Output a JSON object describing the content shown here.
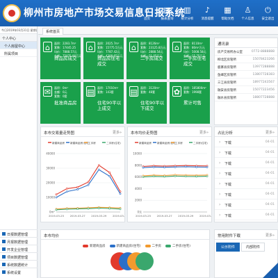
{
  "header": {
    "title": "柳州市房地产市场交易信息日报系统",
    "nav": [
      {
        "icon": "home-icon",
        "glyph": "⌂",
        "label": "首页"
      },
      {
        "icon": "document-icon",
        "glyph": "▤",
        "label": "报表查询"
      },
      {
        "icon": "chart-icon",
        "glyph": "▥",
        "label": "统计分析"
      },
      {
        "icon": "bell-icon",
        "glyph": "♪",
        "label": "消息提醒"
      },
      {
        "icon": "book-icon",
        "glyph": "▦",
        "label": "帮助文档"
      },
      {
        "icon": "user-icon",
        "glyph": "♙",
        "label": "个人信息"
      },
      {
        "icon": "exit-icon",
        "glyph": "⏻",
        "label": "安全退出"
      }
    ]
  },
  "sidebar": {
    "today": "今日2019年03月31日 星期日",
    "group_label": "个人中心",
    "items": [
      {
        "label": "个人房屋中心"
      },
      {
        "label": "所属项目"
      }
    ],
    "modules": [
      {
        "label": "日报数据管理"
      },
      {
        "label": "月报数据管理"
      },
      {
        "label": "开发企业管理"
      },
      {
        "label": "项目数据管理"
      },
      {
        "label": "系统数据统计"
      },
      {
        "label": "系统设置"
      }
    ]
  },
  "tabbar": {
    "home_tab": "系统首页"
  },
  "tiles": [
    {
      "icon": "house-icon",
      "glyph": "⌂",
      "lines": [
        "面积：2283.7m²",
        "套数：17445.25",
        "均价：7888.57元",
        "金额：75875.88万元"
      ],
      "name": "商品房成交"
    },
    {
      "icon": "house-icon",
      "glyph": "⌂",
      "lines": [
        "面积：2025.7m²",
        "套数：15775.5万元",
        "均价：7787.42元",
        "金额：4288.65万元"
      ],
      "name": "商品房住宅成交"
    },
    {
      "icon": "house-icon",
      "glyph": "⌂",
      "lines": [
        "面积：8126m²",
        "套数：23125.8万元",
        "均价：2888.54元",
        "金额：31.05万元"
      ],
      "name": "二手房成交"
    },
    {
      "icon": "house-icon",
      "glyph": "⌂",
      "lines": [
        "面积：8110m²",
        "套数：80m²万元",
        "均价：5008.58元",
        "金额：15.75万元"
      ],
      "name": "二手房住宅成交"
    },
    {
      "icon": "mail-icon",
      "glyph": "✉",
      "lines": [
        "面积：0m²",
        "金额：0元",
        "套数：0套"
      ],
      "name": "批准商品房"
    },
    {
      "icon": "clipboard-icon",
      "glyph": "▤",
      "lines": [
        "面积：17010m²",
        "套数：143套"
      ],
      "name": "住宅90平以上成交"
    },
    {
      "icon": "clipboard-icon",
      "glyph": "▤",
      "lines": [
        "面积：3120m²",
        "套数：48套"
      ],
      "name": "住宅90平以下成交"
    },
    {
      "icon": "gear-icon",
      "glyph": "✿",
      "lines": [
        "面积：185800m²",
        "套数：1998套"
      ],
      "name": "累计可售"
    }
  ],
  "rpanel": {
    "title": "通讯录",
    "rows": [
      {
        "name": "房产交易所办公室",
        "value": "0772-8888888"
      },
      {
        "name": "柳北区房管所",
        "value": "15078423266"
      },
      {
        "name": "鹿寨县房管所",
        "value": "13977288888"
      },
      {
        "name": "鱼峰区房管所",
        "value": "13807728383"
      },
      {
        "name": "三江县房管所",
        "value": "18977243567"
      },
      {
        "name": "融安县房管所",
        "value": "15077223456"
      },
      {
        "name": "融水县房管所",
        "value": "18807728888"
      }
    ]
  },
  "chart_left": {
    "title": "本市交易量走势图",
    "more": "更多»"
  },
  "chart_right": {
    "title": "本市均价走势图",
    "more": "更多»"
  },
  "chart_data": [
    {
      "type": "line",
      "title": "本市交易量走势图",
      "categories": [
        "2019-03-25",
        "2019-03-26",
        "2019-03-27",
        "2019-03-28",
        "2019-03-29",
        "2019-03-30",
        "2019-03-31"
      ],
      "tick_labels": [
        "2019-03-25",
        "2019-03-27",
        "2019-03-29",
        "2019-03-31"
      ],
      "ylim": [
        0,
        40000
      ],
      "y_ticks": [
        "0m²",
        "10000",
        "20000",
        "30000",
        "40000"
      ],
      "series": [
        {
          "name": "新建商品房",
          "color": "#e23a2c",
          "values": [
            12000,
            16000,
            17000,
            20500,
            32000,
            27000,
            14000
          ]
        },
        {
          "name": "新建商品房(住宅)",
          "color": "#2a6fc9",
          "values": [
            10000,
            14000,
            15500,
            18500,
            29000,
            24500,
            12500
          ]
        },
        {
          "name": "二手房",
          "color": "#f29a2e",
          "values": [
            2000,
            2500,
            2600,
            2900,
            3200,
            3000,
            2700
          ]
        },
        {
          "name": "二手房(住宅)",
          "color": "#3aa76d",
          "values": [
            1500,
            1900,
            2100,
            2300,
            2600,
            2400,
            2000
          ]
        }
      ]
    },
    {
      "type": "line",
      "title": "本市均价走势图",
      "categories": [
        "2019-03-25",
        "2019-03-26",
        "2019-03-27",
        "2019-03-28",
        "2019-03-29",
        "2019-03-30",
        "2019-03-31"
      ],
      "tick_labels": [
        "2019-03-25",
        "2019-03-27",
        "2019-03-29",
        "2019-03-31"
      ],
      "ylim": [
        0,
        10000
      ],
      "y_ticks": [
        "0元",
        "2000",
        "4000",
        "6000",
        "8000",
        "10000"
      ],
      "series": [
        {
          "name": "新建商品房",
          "color": "#e23a2c",
          "values": [
            7800,
            7900,
            7850,
            7900,
            7950,
            7900,
            7880
          ]
        },
        {
          "name": "新建商品房(住宅)",
          "color": "#2a6fc9",
          "values": [
            7600,
            7700,
            7650,
            7700,
            7750,
            7700,
            7680
          ]
        },
        {
          "name": "二手房",
          "color": "#f29a2e",
          "values": [
            6200,
            6300,
            6250,
            6350,
            6300,
            6280,
            6320
          ]
        },
        {
          "name": "二手房(住宅)",
          "color": "#3aa76d",
          "values": [
            6000,
            6100,
            6050,
            6150,
            6100,
            6080,
            6120
          ]
        }
      ]
    }
  ],
  "share": {
    "title": "占比分析",
    "more": "更多»",
    "rows": [
      {
        "label": "下载",
        "date": "04-01"
      },
      {
        "label": "下载",
        "date": "04-01"
      },
      {
        "label": "下载",
        "date": "04-01"
      },
      {
        "label": "下载",
        "date": "04-01"
      },
      {
        "label": "下载",
        "date": "04-01"
      },
      {
        "label": "下载",
        "date": "04-01"
      },
      {
        "label": "下载",
        "date": "04-01"
      },
      {
        "label": "下载",
        "date": "04-01"
      }
    ]
  },
  "bottom": {
    "title": "本市均价",
    "legend": [
      {
        "name": "新建商品房",
        "color": "#e23a2c"
      },
      {
        "name": "新建商品房(住宅)",
        "color": "#2a6fc9"
      },
      {
        "name": "二手房",
        "color": "#f29a2e"
      },
      {
        "name": "二手房(住宅)",
        "color": "#3aa76d"
      }
    ]
  },
  "downloads": {
    "title": "常用附件下载",
    "more": "更多»",
    "tabs": [
      {
        "label": "公示附件"
      },
      {
        "label": "内部附件"
      }
    ]
  },
  "colors": {
    "header": "#1a5fae",
    "tile": "#1aa04b",
    "accent": "#1a67b5"
  }
}
